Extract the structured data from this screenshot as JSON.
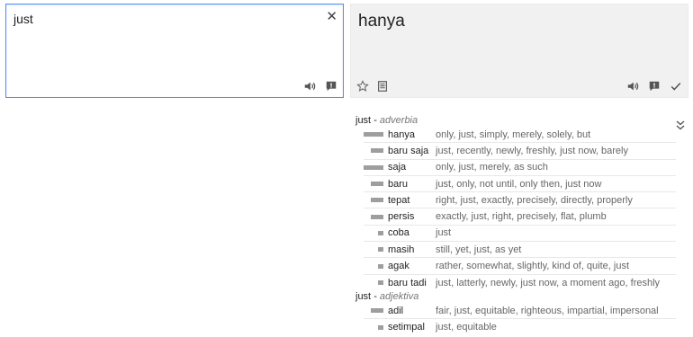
{
  "source": {
    "text": "just",
    "clear_glyph": "✕"
  },
  "target": {
    "text": "hanya"
  },
  "dictionary": [
    {
      "term": "just",
      "sep": "-",
      "pos": "adverbia",
      "entries": [
        {
          "word": "hanya",
          "translations": "only, just, simply, merely, solely, but",
          "frequency": 3
        },
        {
          "word": "baru saja",
          "translations": "just, recently, newly, freshly, just now, barely",
          "frequency": 2
        },
        {
          "word": "saja",
          "translations": "only, just, merely, as such",
          "frequency": 3
        },
        {
          "word": "baru",
          "translations": "just, only, not until, only then, just now",
          "frequency": 2
        },
        {
          "word": "tepat",
          "translations": "right, just, exactly, precisely, directly, properly",
          "frequency": 2
        },
        {
          "word": "persis",
          "translations": "exactly, just, right, precisely, flat, plumb",
          "frequency": 2
        },
        {
          "word": "coba",
          "translations": "just",
          "frequency": 1
        },
        {
          "word": "masih",
          "translations": "still, yet, just, as yet",
          "frequency": 1
        },
        {
          "word": "agak",
          "translations": "rather, somewhat, slightly, kind of, quite, just",
          "frequency": 1
        },
        {
          "word": "baru tadi",
          "translations": "just, latterly, newly, just now, a moment ago, freshly",
          "frequency": 1
        }
      ]
    },
    {
      "term": "just",
      "sep": "-",
      "pos": "adjektiva",
      "entries": [
        {
          "word": "adil",
          "translations": "fair, just, equitable, righteous, impartial, impersonal",
          "frequency": 2
        },
        {
          "word": "setimpal",
          "translations": "just, equitable",
          "frequency": 1
        }
      ]
    }
  ],
  "colors": {
    "accent_border": "#4d90fe",
    "target_bg": "#f1f1f1",
    "freq_bar": "#9e9e9e"
  }
}
